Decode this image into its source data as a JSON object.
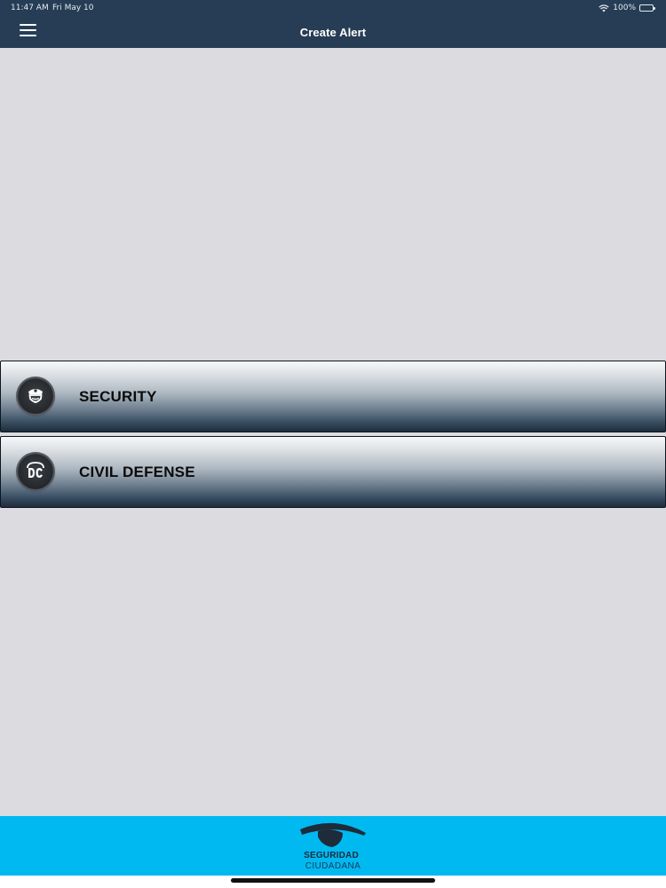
{
  "status_bar": {
    "time": "11:47 AM",
    "date": "Fri May 10",
    "battery": "100%",
    "icons": [
      "wifi-icon",
      "battery-icon"
    ]
  },
  "header": {
    "title": "Create Alert",
    "menu_icon": "hamburger-menu-icon",
    "background_color": "#263d55"
  },
  "alerts": [
    {
      "label": "SECURITY",
      "icon": "security-guard-icon"
    },
    {
      "label": "CIVIL DEFENSE",
      "icon": "civil-defense-dc-icon"
    }
  ],
  "footer": {
    "logo_line1": "SEGURIDAD",
    "logo_line2": "CIUDADANA",
    "logo_icon": "eye-logo-icon",
    "background_color": "#00b9f1"
  }
}
